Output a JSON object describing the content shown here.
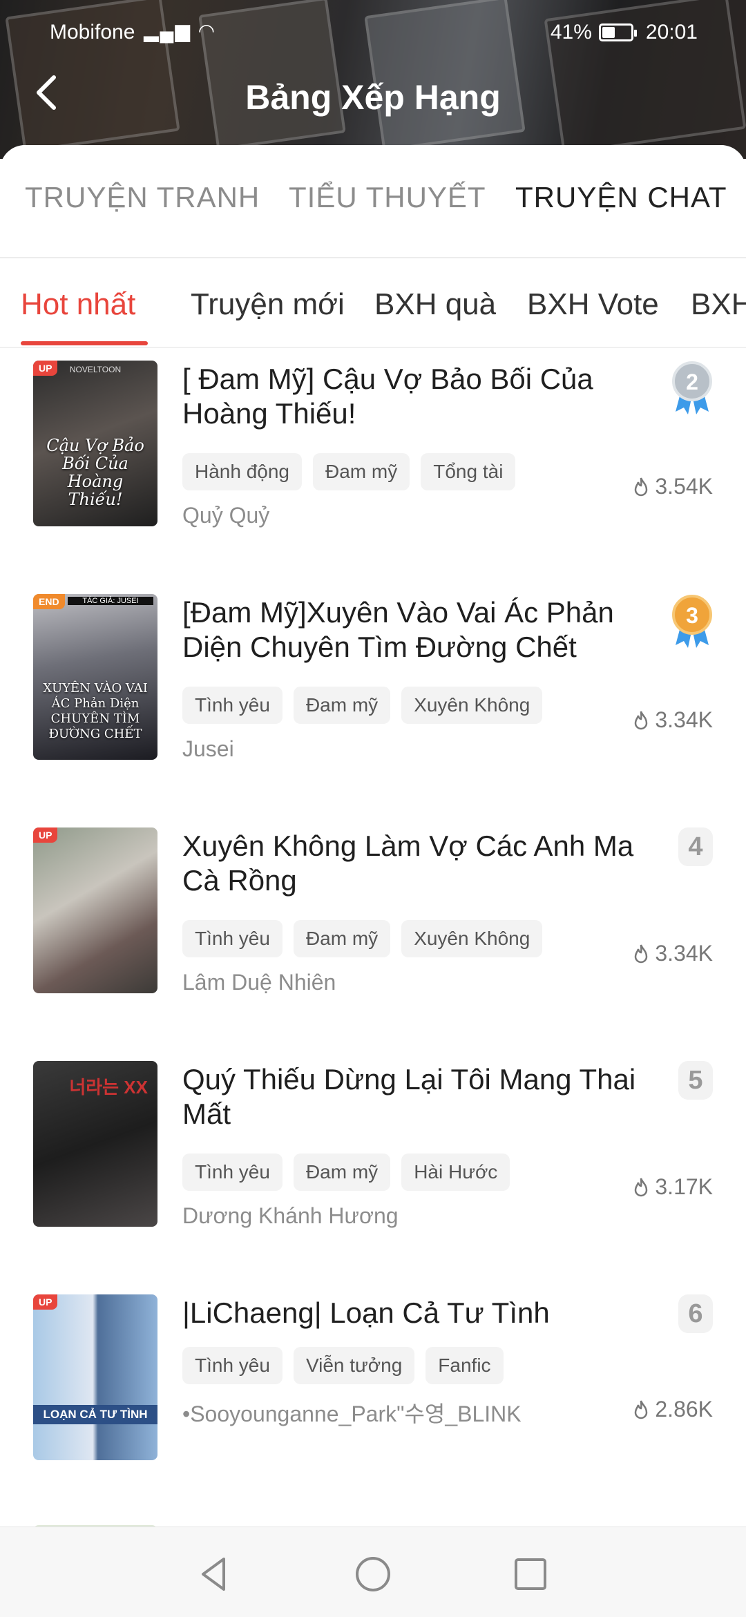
{
  "status": {
    "carrier": "Mobifone",
    "battery": "41%",
    "time": "20:01"
  },
  "header": {
    "title": "Bảng Xếp Hạng"
  },
  "main_tabs": [
    {
      "label": "TRUYỆN TRANH"
    },
    {
      "label": "TIỂU THUYẾT"
    },
    {
      "label": "TRUYỆN CHAT"
    }
  ],
  "sub_tabs": [
    {
      "label": "Hot nhất"
    },
    {
      "label": "Truyện mới"
    },
    {
      "label": "BXH quà"
    },
    {
      "label": "BXH Vote"
    },
    {
      "label": "BXH"
    }
  ],
  "items": [
    {
      "title": "[ Đam Mỹ] Cậu Vợ Bảo Bối Của Hoàng Thiếu!",
      "tags": [
        "Hành động",
        "Đam mỹ",
        "Tổng tài"
      ],
      "author": "Quỷ Quỷ",
      "views": "3.54K",
      "rank": "2",
      "badge": "UP",
      "cover_text": "Cậu Vợ Bảo Bối Của Hoàng Thiếu!",
      "cover_top": "NOVELTOON"
    },
    {
      "title": "[Đam Mỹ]Xuyên Vào Vai Ác Phản Diện Chuyên Tìm Đường Chết",
      "tags": [
        "Tình yêu",
        "Đam mỹ",
        "Xuyên Không"
      ],
      "author": "Jusei",
      "views": "3.34K",
      "rank": "3",
      "badge": "END",
      "cover_text": "XUYÊN VÀO VAI ÁC Phản Diện CHUYÊN TÌM ĐƯỜNG CHẾT",
      "cover_top": "TÁC GIẢ: JUSEI"
    },
    {
      "title": "Xuyên Không Làm Vợ Các Anh Ma Cà Rồng",
      "tags": [
        "Tình yêu",
        "Đam mỹ",
        "Xuyên Không"
      ],
      "author": "Lâm Duệ Nhiên",
      "views": "3.34K",
      "rank": "4",
      "badge": "UP"
    },
    {
      "title": "Quý Thiếu Dừng Lại Tôi Mang Thai Mất",
      "tags": [
        "Tình yêu",
        "Đam mỹ",
        "Hài Hước"
      ],
      "author": "Dương Khánh Hương",
      "views": "3.17K",
      "rank": "5",
      "badge": "",
      "cover_text": "너라는 XX"
    },
    {
      "title": "|LiChaeng| Loạn Cả Tư Tình",
      "tags": [
        "Tình yêu",
        "Viễn tưởng",
        "Fanfic"
      ],
      "author": "•Sooyounganne_Park\"수영_BLINK",
      "views": "2.86K",
      "rank": "6",
      "badge": "UP",
      "cover_text": "LOẠN CẢ TƯ TÌNH"
    }
  ],
  "colors": {
    "accent": "#e8453c",
    "silver": "#b8c0c8",
    "gold": "#f0a43a",
    "ribbon": "#3d9be9"
  },
  "icons": [
    "back-arrow-icon",
    "flame-icon",
    "silver-medal-icon",
    "gold-medal-icon",
    "nav-back-icon",
    "nav-home-icon",
    "nav-recents-icon"
  ]
}
